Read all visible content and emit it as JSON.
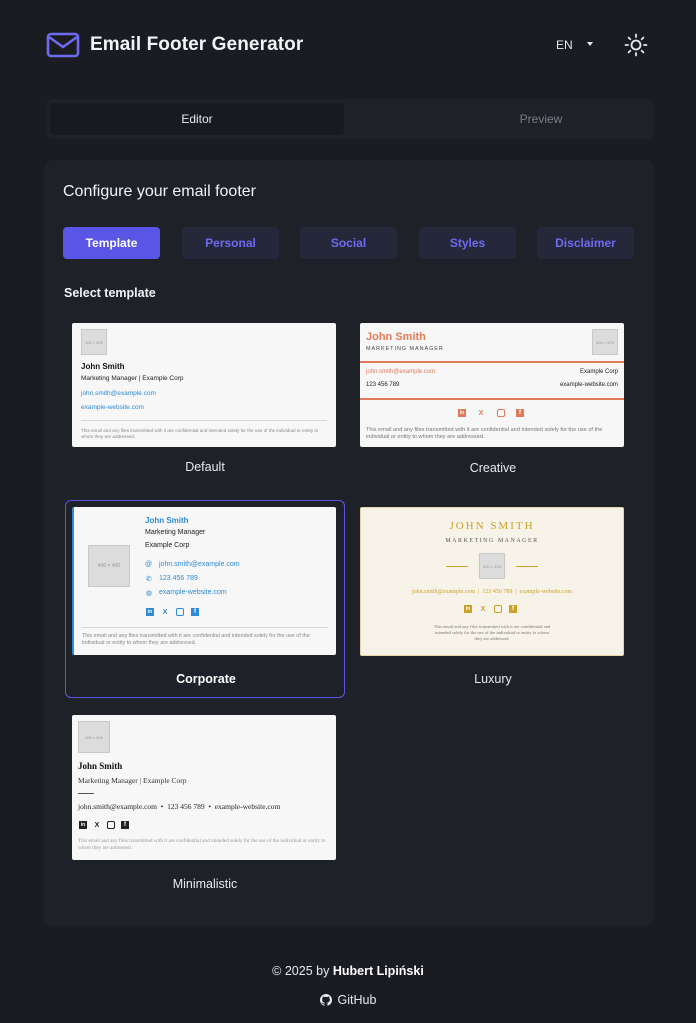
{
  "app": {
    "title": "Email Footer Generator",
    "language": "EN"
  },
  "mode_tabs": [
    "Editor",
    "Preview"
  ],
  "panel": {
    "title": "Configure your email footer",
    "sections": [
      "Template",
      "Personal",
      "Social",
      "Styles",
      "Disclaimer"
    ],
    "select_label": "Select template"
  },
  "sample": {
    "name": "John Smith",
    "name_upper": "JOHN SMITH",
    "role": "Marketing Manager",
    "role_upper": "MARKETING MANAGER",
    "company": "Example Corp",
    "role_company": "Marketing Manager | Example Corp",
    "email": "john.smith@example.com",
    "phone": "123 456 789",
    "website": "example-website.com",
    "luxury_contact": "john.smith@example.com  |  123 456 789  |  example-website.com",
    "minimal_contact": "john.smith@example.com  •  123 456 789  •  example-website.com",
    "disclaimer": "This email and any files transmitted with it are confidential and intended solely for the use of the individual or entity to whom they are addressed.",
    "placeholder": "400 × 400"
  },
  "templates": [
    {
      "label": "Default"
    },
    {
      "label": "Creative"
    },
    {
      "label": "Corporate",
      "selected": true
    },
    {
      "label": "Luxury"
    },
    {
      "label": "Minimalistic"
    }
  ],
  "colors": {
    "accent": "#5b55e6",
    "creative": "#e07b57",
    "corporate": "#2e8bd6",
    "luxury": "#c9a227"
  },
  "footer": {
    "prefix": "© 2025 by",
    "author": "Hubert Lipiński",
    "link": "GitHub"
  }
}
